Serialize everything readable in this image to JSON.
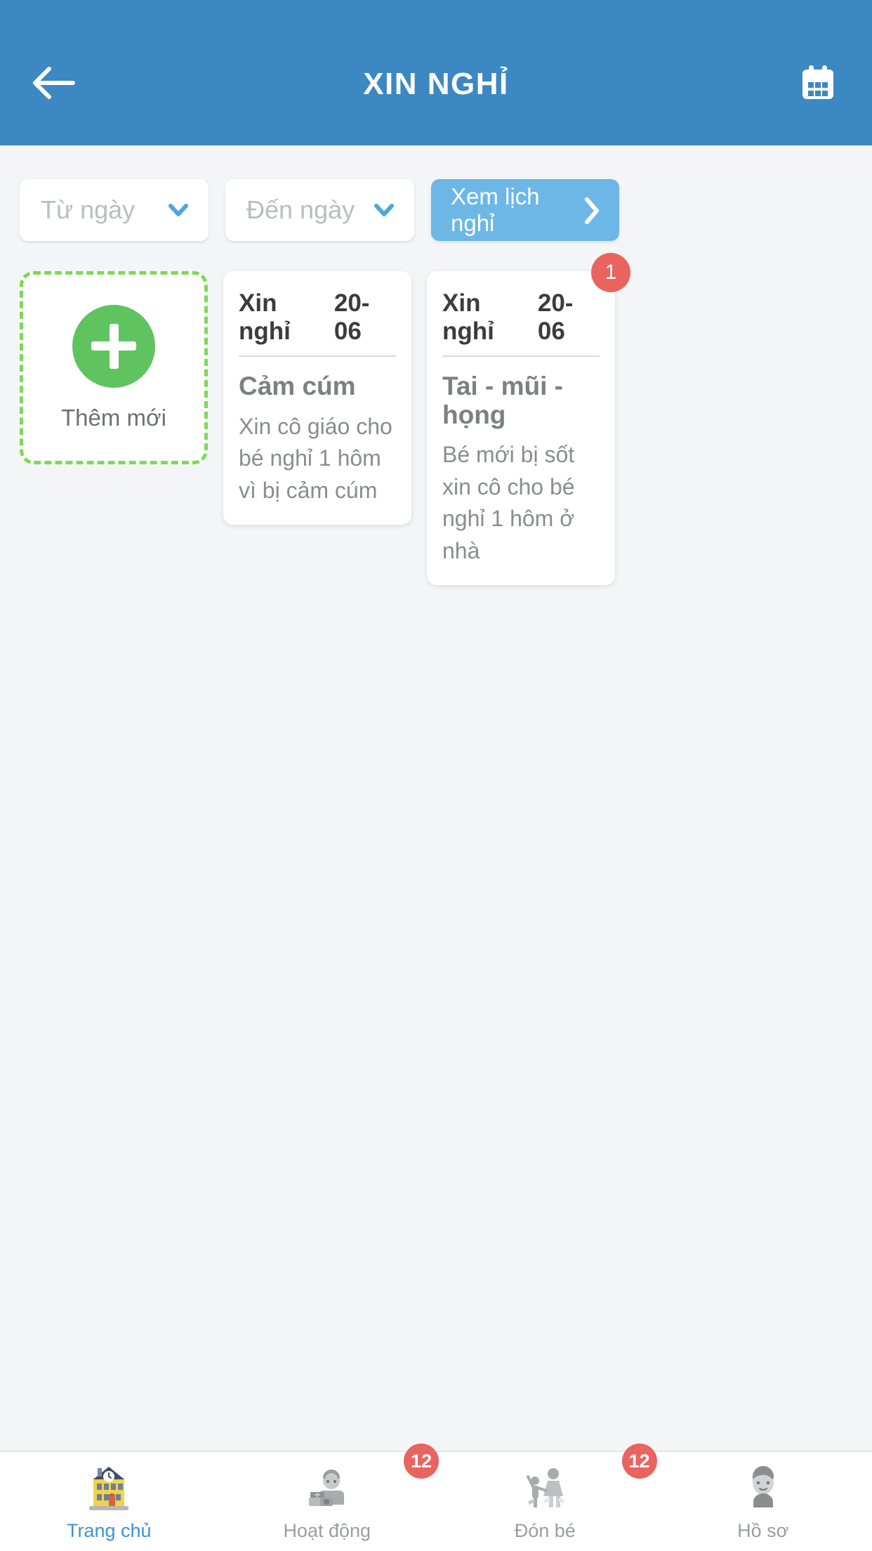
{
  "header": {
    "title": "XIN NGHỈ",
    "back_icon": "arrow-left-icon",
    "calendar_icon": "calendar-icon",
    "background_color": "#3b88c3"
  },
  "filters": {
    "from_date": {
      "placeholder": "Từ ngày",
      "value": "",
      "chevron_icon": "chevron-down-icon"
    },
    "to_date": {
      "placeholder": "Đến ngày",
      "value": "",
      "chevron_icon": "chevron-down-icon"
    },
    "view_schedule_button": {
      "label": "Xem lịch nghỉ",
      "chevron_icon": "chevron-right-icon",
      "color": "#6cb7e6"
    }
  },
  "add_card": {
    "label": "Thêm mới",
    "plus_icon": "plus-icon",
    "border_color": "#7ed957",
    "circle_color": "#5fc35f"
  },
  "leave_cards": [
    {
      "head_label": "Xin nghỉ",
      "date": "20-06",
      "title": "Cảm cúm",
      "body": "Xin cô giáo cho bé nghỉ 1 hôm vì bị cảm cúm",
      "badge": ""
    },
    {
      "head_label": "Xin nghỉ",
      "date": "20-06",
      "title": "Tai - mũi - họng",
      "body": "Bé mới bị sốt xin cô cho bé nghỉ 1 hôm ở nhà",
      "badge": "1"
    }
  ],
  "bottom_nav": {
    "badge_color": "#e9635f",
    "active_color": "#3b95d6",
    "items": [
      {
        "label": "Trang chủ",
        "icon": "school-building-icon",
        "badge": "",
        "active": true
      },
      {
        "label": "Hoạt động",
        "icon": "child-playing-blocks-icon",
        "badge": "12",
        "active": false
      },
      {
        "label": "Đón bé",
        "icon": "parent-child-pickup-icon",
        "badge": "12",
        "active": false
      },
      {
        "label": "Hồ sơ",
        "icon": "person-avatar-icon",
        "badge": "",
        "active": false
      }
    ]
  }
}
